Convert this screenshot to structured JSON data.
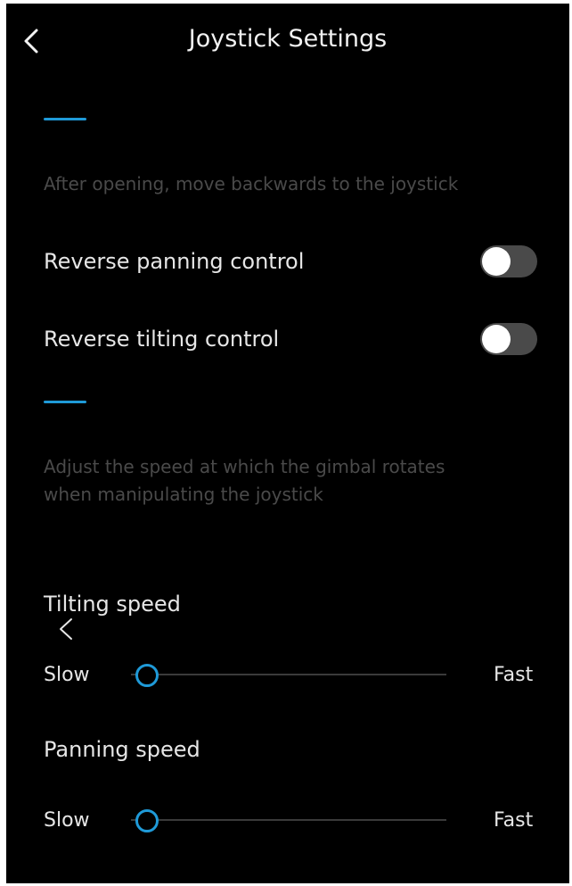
{
  "header": {
    "title": "Joystick Settings",
    "back_icon": "chevron-left-icon"
  },
  "colors": {
    "background": "#000000",
    "accent": "#1f9ad8",
    "toggle_off_track": "#4a4a4a",
    "description_text": "#4a4a4a"
  },
  "reverse_section": {
    "description": "After opening, move backwards to the joystick",
    "rows": [
      {
        "label": "Reverse panning control",
        "enabled": false
      },
      {
        "label": "Reverse tilting control",
        "enabled": false
      }
    ]
  },
  "speed_section": {
    "description_line1": "Adjust the speed at which the gimbal rotates",
    "description_line2": "when manipulating the joystick",
    "sliders": [
      {
        "label": "Tilting speed",
        "min_label": "Slow",
        "max_label": "Fast",
        "value_fraction": 0.05
      },
      {
        "label": "Panning speed",
        "min_label": "Slow",
        "max_label": "Fast",
        "value_fraction": 0.05
      }
    ]
  }
}
